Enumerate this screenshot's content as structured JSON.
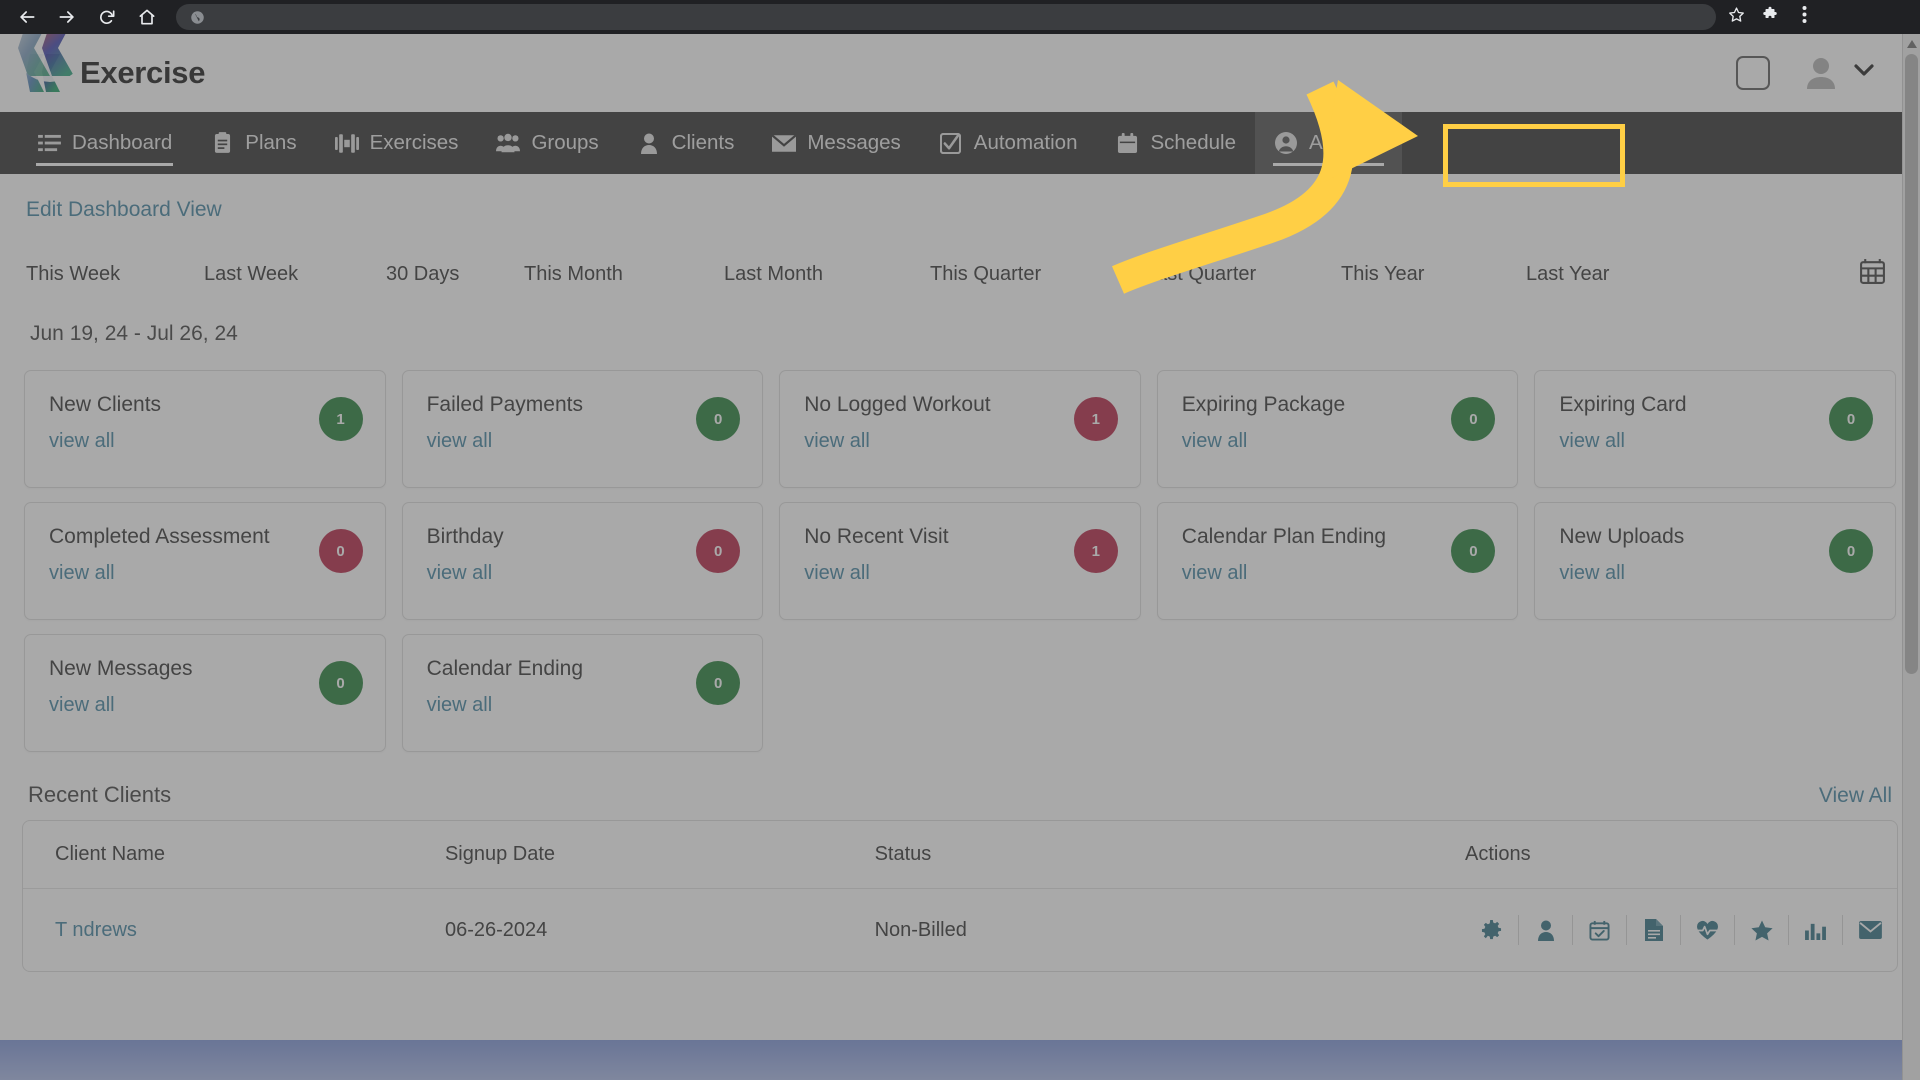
{
  "browser": {
    "back_icon": "back-arrow-icon",
    "forward_icon": "forward-arrow-icon",
    "reload_icon": "reload-icon",
    "home_icon": "home-icon",
    "omnibox_value": "",
    "omnibox_placeholder": "",
    "omnibox_icon": "globe-icon",
    "bookmark_icon": "star-icon",
    "extensions_icon": "puzzle-icon",
    "menu_icon": "three-dot-menu-icon"
  },
  "header": {
    "brand_name": "Exercise",
    "brand_logo_icon": "exercise-chevron-logo",
    "square_icon": "square-outline-icon",
    "user_avatar_icon": "user-avatar-icon",
    "chevron_icon": "chevron-down-icon"
  },
  "nav": {
    "items": [
      {
        "label": "Dashboard",
        "icon": "list-icon",
        "active": true,
        "highlighted": false
      },
      {
        "label": "Plans",
        "icon": "clipboard-icon",
        "active": false,
        "highlighted": false
      },
      {
        "label": "Exercises",
        "icon": "dumbbell-icon",
        "active": false,
        "highlighted": false
      },
      {
        "label": "Groups",
        "icon": "people-icon",
        "active": false,
        "highlighted": false
      },
      {
        "label": "Clients",
        "icon": "person-icon",
        "active": false,
        "highlighted": false
      },
      {
        "label": "Messages",
        "icon": "envelope-icon",
        "active": false,
        "highlighted": false
      },
      {
        "label": "Automation",
        "icon": "checkbox-icon",
        "active": false,
        "highlighted": false
      },
      {
        "label": "Schedule",
        "icon": "calendar-icon",
        "active": false,
        "highlighted": false
      },
      {
        "label": "Account",
        "icon": "account-circle-icon",
        "active": false,
        "highlighted": true
      }
    ]
  },
  "main": {
    "edit_dashboard_link": "Edit Dashboard View",
    "filters": [
      "This Week",
      "Last Week",
      "30 Days",
      "This Month",
      "Last Month",
      "This Quarter",
      "Last Quarter",
      "This Year",
      "Last Year"
    ],
    "calendar_icon": "calendar-picker-icon",
    "date_range": "Jun 19, 24 - Jul 26, 24",
    "cards": [
      {
        "title": "New Clients",
        "count": "1",
        "color": "green",
        "link": "view all"
      },
      {
        "title": "Failed Payments",
        "count": "0",
        "color": "green",
        "link": "view all"
      },
      {
        "title": "No Logged Workout",
        "count": "1",
        "color": "red",
        "link": "view all"
      },
      {
        "title": "Expiring Package",
        "count": "0",
        "color": "green",
        "link": "view all"
      },
      {
        "title": "Expiring Card",
        "count": "0",
        "color": "green",
        "link": "view all"
      },
      {
        "title": "Completed Assessment",
        "count": "0",
        "color": "red",
        "link": "view all"
      },
      {
        "title": "Birthday",
        "count": "0",
        "color": "red",
        "link": "view all"
      },
      {
        "title": "No Recent Visit",
        "count": "1",
        "color": "red",
        "link": "view all"
      },
      {
        "title": "Calendar Plan Ending",
        "count": "0",
        "color": "green",
        "link": "view all"
      },
      {
        "title": "New Uploads",
        "count": "0",
        "color": "green",
        "link": "view all"
      },
      {
        "title": "New Messages",
        "count": "0",
        "color": "green",
        "link": "view all"
      },
      {
        "title": "Calendar Ending",
        "count": "0",
        "color": "green",
        "link": "view all"
      }
    ],
    "recent_clients": {
      "title": "Recent Clients",
      "view_all": "View All",
      "columns": [
        "Client Name",
        "Signup Date",
        "Status",
        "Actions"
      ],
      "rows": [
        {
          "name": "T          ndrews",
          "signup_date": "06-26-2024",
          "status": "Non-Billed",
          "avatar_icon": "client-avatar-icon",
          "actions": [
            "settings-gear-icon",
            "client-profile-icon",
            "calendar-check-icon",
            "document-icon",
            "heartbeat-icon",
            "star-icon",
            "bar-chart-icon",
            "envelope-icon"
          ]
        }
      ]
    }
  },
  "colors": {
    "accent_link": "#3b7f9e",
    "badge_green": "#1e7b34",
    "badge_red": "#b51e3f",
    "nav_bg": "#2b2b2b",
    "highlight_yellow": "#ffcf45",
    "action_icon": "#2a6d80"
  }
}
